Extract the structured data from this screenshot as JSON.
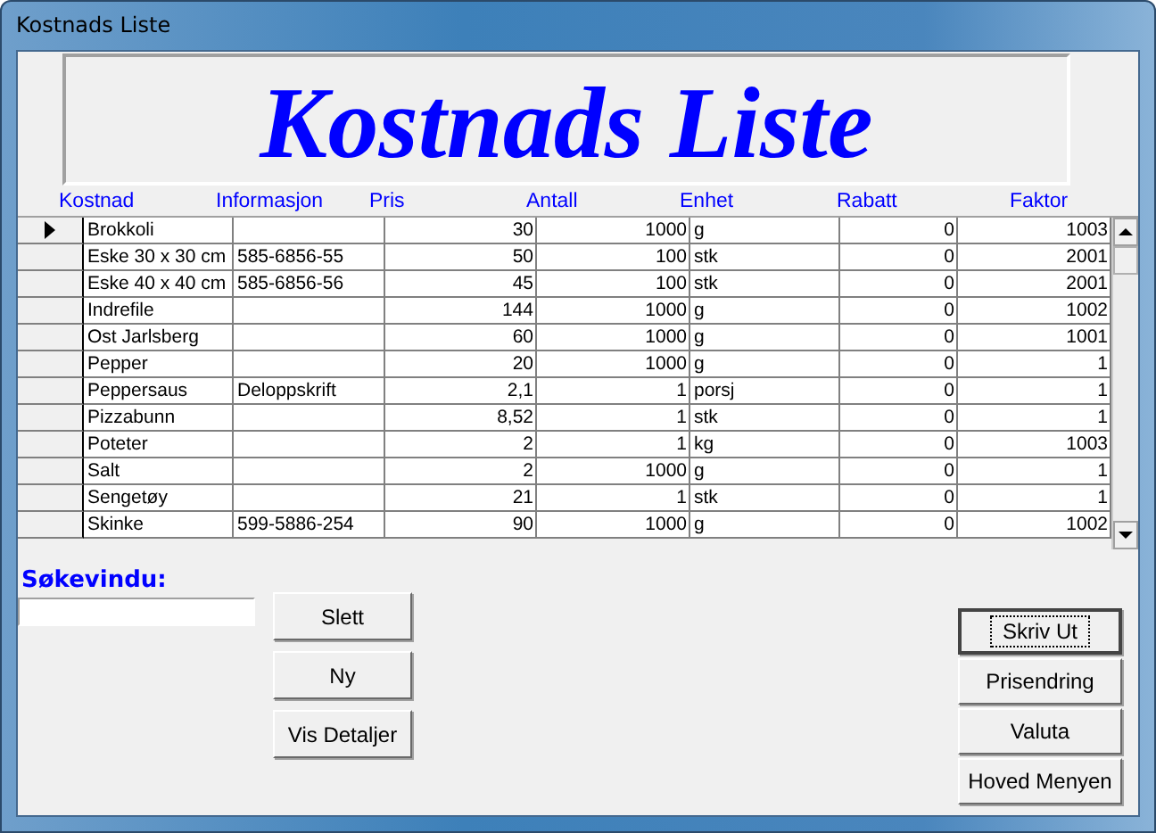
{
  "window": {
    "title": "Kostnads Liste"
  },
  "banner": {
    "title": "Kostnads Liste"
  },
  "table": {
    "columns": [
      {
        "label": "Kostnad",
        "kind": "text"
      },
      {
        "label": "Informasjon",
        "kind": "text"
      },
      {
        "label": "Pris",
        "kind": "number"
      },
      {
        "label": "Antall",
        "kind": "number"
      },
      {
        "label": "Enhet",
        "kind": "text"
      },
      {
        "label": "Rabatt",
        "kind": "number"
      },
      {
        "label": "Faktor",
        "kind": "number"
      }
    ],
    "rows": [
      {
        "current": true,
        "cells": [
          "Brokkoli",
          "",
          "30",
          "1000",
          "g",
          "0",
          "1003"
        ]
      },
      {
        "current": false,
        "cells": [
          "Eske 30 x 30 cm",
          "585-6856-55",
          "50",
          "100",
          "stk",
          "0",
          "2001"
        ]
      },
      {
        "current": false,
        "cells": [
          "Eske 40 x 40 cm",
          "585-6856-56",
          "45",
          "100",
          "stk",
          "0",
          "2001"
        ]
      },
      {
        "current": false,
        "cells": [
          "Indrefile",
          "",
          "144",
          "1000",
          "g",
          "0",
          "1002"
        ]
      },
      {
        "current": false,
        "cells": [
          "Ost Jarlsberg",
          "",
          "60",
          "1000",
          "g",
          "0",
          "1001"
        ]
      },
      {
        "current": false,
        "cells": [
          "Pepper",
          "",
          "20",
          "1000",
          "g",
          "0",
          "1"
        ]
      },
      {
        "current": false,
        "cells": [
          "Peppersaus",
          "Deloppskrift",
          "2,1",
          "1",
          "porsj",
          "0",
          "1"
        ]
      },
      {
        "current": false,
        "cells": [
          "Pizzabunn",
          "",
          "8,52",
          "1",
          "stk",
          "0",
          "1"
        ]
      },
      {
        "current": false,
        "cells": [
          "Poteter",
          "",
          "2",
          "1",
          "kg",
          "0",
          "1003"
        ]
      },
      {
        "current": false,
        "cells": [
          "Salt",
          "",
          "2",
          "1000",
          "g",
          "0",
          "1"
        ]
      },
      {
        "current": false,
        "cells": [
          "Sengetøy",
          "",
          "21",
          "1",
          "stk",
          "0",
          "1"
        ]
      },
      {
        "current": false,
        "cells": [
          "Skinke",
          "599-5886-254",
          "90",
          "1000",
          "g",
          "0",
          "1002"
        ]
      }
    ]
  },
  "search": {
    "label": "Søkevindu:"
  },
  "left_buttons": [
    {
      "label": "Slett",
      "default": false
    },
    {
      "label": "Ny",
      "default": false
    },
    {
      "label": "Vis Detaljer",
      "default": false
    }
  ],
  "right_buttons": [
    {
      "label": "Skriv Ut",
      "default": true
    },
    {
      "label": "Prisendring",
      "default": false
    },
    {
      "label": "Valuta",
      "default": false
    },
    {
      "label": "Hoved Menyen",
      "default": false
    }
  ]
}
